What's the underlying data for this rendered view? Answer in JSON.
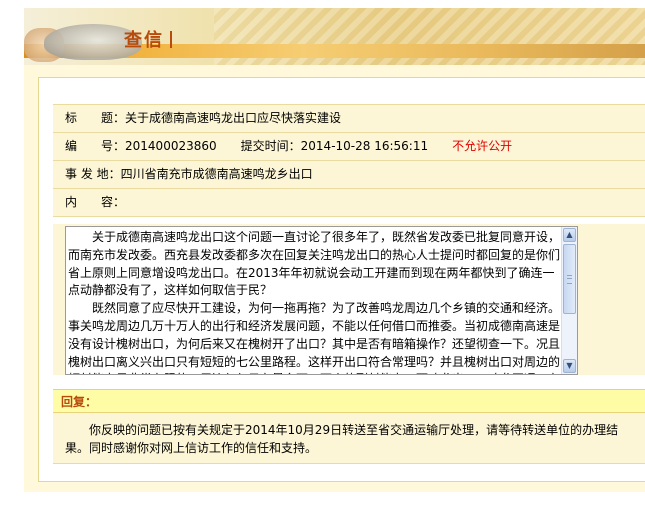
{
  "header": {
    "title": "查信"
  },
  "info": {
    "title_label": "标　　题：",
    "title_value": "关于成德南高速鸣龙出口应尽快落实建设",
    "number_label": "编　　号：",
    "number_value": "201400023860",
    "submit_label": "提交时间：",
    "submit_value": "2014-10-28 16:56:11",
    "visibility": "不允许公开",
    "location_label": "事 发 地：",
    "location_value": "四川省南充市成德南高速鸣龙乡出口",
    "content_label": "内　　容："
  },
  "content": {
    "paragraphs": [
      "关于成德南高速鸣龙出口这个问题一直讨论了很多年了，既然省发改委已批复同意开设，而南充市发改委。西充县发改委都多次在回复关注鸣龙出口的热心人士提问时都回复的是你们省上原则上同意增设鸣龙出口。在2013年年初就说会动工开建而到现在两年都快到了确连一点动静都没有了，这样如何取信于民？",
      "既然同意了应尽快开工建设，为何一拖再拖？为了改善鸣龙周边几个乡镇的交通和经济。事关鸣龙周边几万十万人的出行和经济发展问题，不能以任何借口而推委。当初成德南高速是没有设计槐树出口，为何后来又在槐树开了出口？其中是否有暗箱操作？还望彻查一下。况且槐树出口离义兴出口只有短短的七公里路程。这样开出口符合常理吗？并且槐树出口对周边的幅射能力是非常有限的，周边仅仅只有最多两三万人的副射能力。而鸣龙出口。鸣龙互通，有利于蹿"
    ]
  },
  "reply": {
    "heading": "回复：",
    "text": "你反映的问题已按有关规定于2014年10月29日转送至省交通运输厅处理，请等待转送单位的办理结果。同时感谢你对网上信访工作的信任和支持。"
  },
  "colors": {
    "accent": "#b84a0a",
    "alert": "#e00000",
    "row_bg": "#fdf6d6",
    "reply_head_bg": "#fffca6"
  },
  "icons": {
    "scroll_up": "scroll-up-icon",
    "scroll_down": "scroll-down-icon"
  }
}
